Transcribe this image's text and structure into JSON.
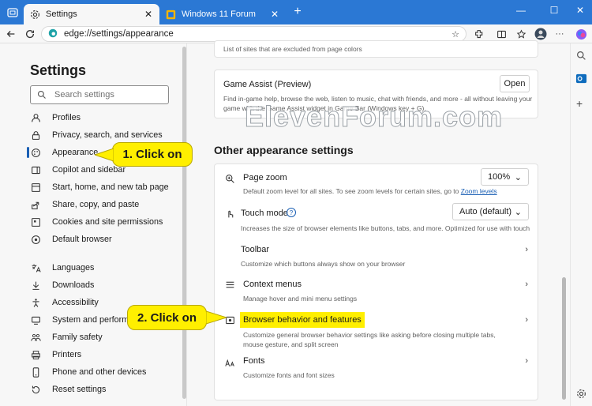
{
  "browser": {
    "tabs": [
      {
        "label": "Settings",
        "icon": "gear-icon"
      },
      {
        "label": "Windows 11 Forum",
        "icon": "forum-icon"
      }
    ],
    "url": "edge://settings/appearance"
  },
  "settings": {
    "title": "Settings",
    "search_placeholder": "Search settings",
    "nav": [
      {
        "label": "Profiles",
        "icon": "profile-icon"
      },
      {
        "label": "Privacy, search, and services",
        "icon": "lock-icon"
      },
      {
        "label": "Appearance",
        "icon": "appearance-icon",
        "selected": true
      },
      {
        "label": "Copilot and sidebar",
        "icon": "sidebar-icon"
      },
      {
        "label": "Start, home, and new tab page",
        "icon": "home-icon"
      },
      {
        "label": "Share, copy, and paste",
        "icon": "share-icon"
      },
      {
        "label": "Cookies and site permissions",
        "icon": "cookie-icon"
      },
      {
        "label": "Default browser",
        "icon": "browser-icon"
      },
      {
        "label": "Languages",
        "icon": "language-icon"
      },
      {
        "label": "Downloads",
        "icon": "download-icon"
      },
      {
        "label": "Accessibility",
        "icon": "accessibility-icon"
      },
      {
        "label": "System and performance",
        "icon": "system-icon"
      },
      {
        "label": "Family safety",
        "icon": "family-icon"
      },
      {
        "label": "Printers",
        "icon": "printer-icon"
      },
      {
        "label": "Phone and other devices",
        "icon": "phone-icon"
      },
      {
        "label": "Reset settings",
        "icon": "reset-icon"
      }
    ]
  },
  "main": {
    "top_card_text": "List of sites that are excluded from page colors",
    "game_assist": {
      "title": "Game Assist (Preview)",
      "description": "Find in-game help, browse the web, listen to music, chat with friends, and more - all without leaving your game with the Game Assist widget in Game Bar (Windows key + G).",
      "button": "Open"
    },
    "section_title": "Other appearance settings",
    "rows": [
      {
        "title": "Page zoom",
        "desc": "Default zoom level for all sites. To see zoom levels for certain sites, go to",
        "link": "Zoom levels",
        "value": "100%",
        "icon": "zoom-icon"
      },
      {
        "title": "Touch mode",
        "desc": "Increases the size of browser elements like buttons, tabs, and more. Optimized for use with touch",
        "value": "Auto (default)",
        "icon": "touch-icon"
      },
      {
        "title": "Toolbar",
        "desc": "Customize which buttons always show on your browser",
        "icon": "toolbar-icon"
      },
      {
        "title": "Context menus",
        "desc": "Manage hover and mini menu settings",
        "icon": "menu-icon"
      },
      {
        "title": "Browser behavior and features",
        "desc": "Customize general browser behavior settings like asking before closing multiple tabs, mouse gesture, and split screen",
        "icon": "behavior-icon"
      },
      {
        "title": "Fonts",
        "desc": "Customize fonts and font sizes",
        "icon": "fonts-icon"
      }
    ]
  },
  "callouts": {
    "step1": "1. Click on",
    "step2": "2. Click on"
  },
  "watermark": "ElevenForum.com",
  "colors": {
    "accent": "#2b78d4",
    "highlight": "#ffef00",
    "link": "#1a5fb4"
  }
}
